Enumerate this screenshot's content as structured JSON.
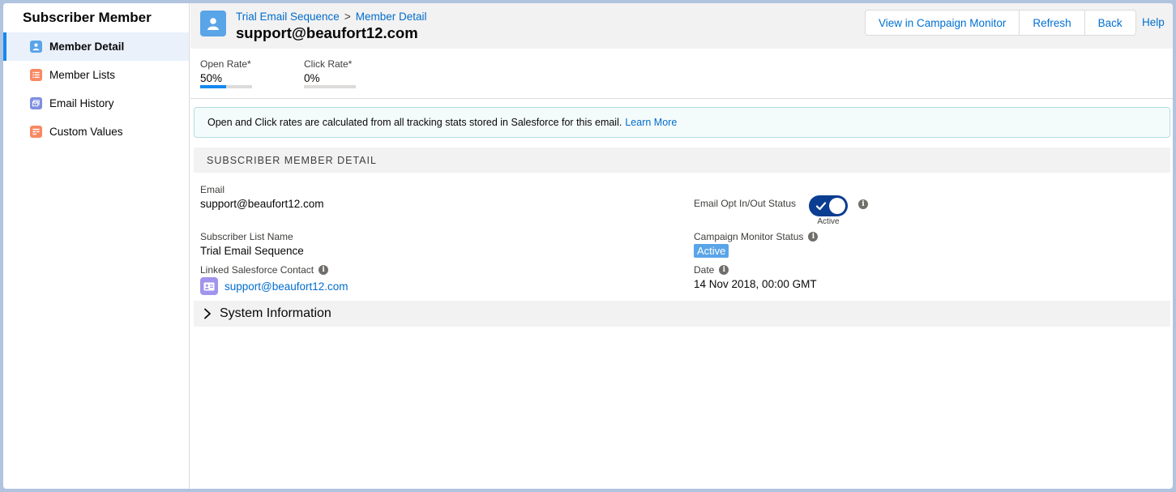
{
  "sidebar": {
    "title": "Subscriber Member",
    "items": [
      {
        "label": "Member Detail",
        "icon": "contact-icon",
        "color": "#5aa4e8"
      },
      {
        "label": "Member Lists",
        "icon": "list-icon",
        "color": "#f88962"
      },
      {
        "label": "Email History",
        "icon": "email-history-icon",
        "color": "#7f8de1"
      },
      {
        "label": "Custom Values",
        "icon": "custom-values-icon",
        "color": "#f88962"
      }
    ]
  },
  "header": {
    "breadcrumb": [
      "Trial Email Sequence",
      "Member Detail"
    ],
    "breadcrumb_separator": ">",
    "title": "support@beaufort12.com",
    "buttons": {
      "view_in_cm": "View in Campaign Monitor",
      "refresh": "Refresh",
      "back": "Back"
    },
    "help": "Help"
  },
  "stats": {
    "open_rate": {
      "label": "Open Rate*",
      "value": "50%",
      "fraction": 0.5
    },
    "click_rate": {
      "label": "Click Rate*",
      "value": "0%",
      "fraction": 0
    }
  },
  "info_box": {
    "text": "Open and Click rates are calculated from all tracking stats stored in Salesforce for this email.",
    "link": "Learn More"
  },
  "section": {
    "title": "SUBSCRIBER MEMBER DETAIL"
  },
  "fields": {
    "email": {
      "label": "Email",
      "value": "support@beaufort12.com"
    },
    "opt_status": {
      "label": "Email Opt In/Out Status",
      "toggle_label": "Active",
      "on": true
    },
    "list_name": {
      "label": "Subscriber List Name",
      "value": "Trial Email Sequence"
    },
    "cm_status": {
      "label": "Campaign Monitor Status",
      "value": "Active"
    },
    "linked_contact": {
      "label": "Linked Salesforce Contact",
      "value": "support@beaufort12.com"
    },
    "date": {
      "label": "Date",
      "value": "14 Nov 2018, 00:00 GMT"
    }
  },
  "system_info": {
    "label": "System Information"
  },
  "colors": {
    "accent": "#0070d2",
    "active_badge": "#5aa4e8",
    "toggle_on": "#0b3d91"
  }
}
